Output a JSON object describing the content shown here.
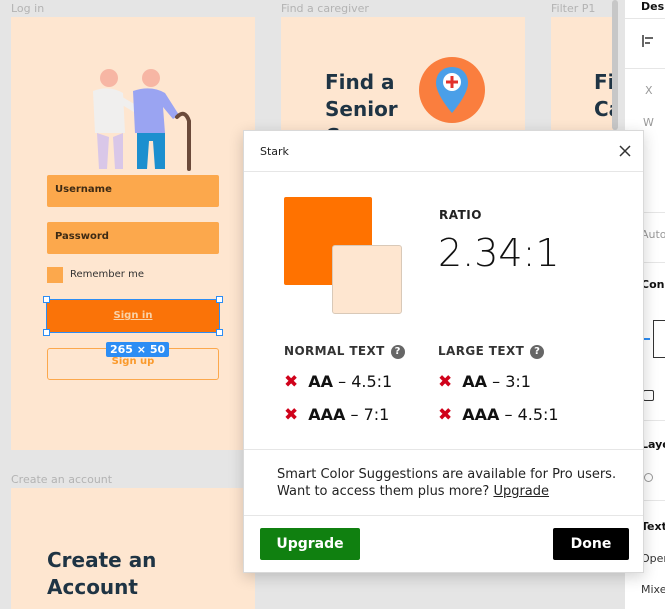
{
  "canvas": {
    "frames": {
      "login": {
        "label": "Log in",
        "username_label": "Username",
        "password_label": "Password",
        "remember_label": "Remember me",
        "signin_label": "Sign in",
        "signup_label": "Sign up",
        "selection_size": "265 × 50"
      },
      "caregiver": {
        "label": "Find a caregiver",
        "heading_line1": "Find a",
        "heading_line2": "Senior",
        "heading_line3": "Care..."
      },
      "filter": {
        "label": "Filter P1",
        "heading_line1": "Filt",
        "heading_line2": "Cat"
      },
      "create": {
        "label": "Create an account",
        "heading_line1": "Create an",
        "heading_line2": "Account"
      }
    }
  },
  "right_panel": {
    "tab": "Desig",
    "x_label": "X",
    "w_label": "W",
    "auto_label": "Auto",
    "constraints_label": "Cons",
    "layer_label": "Laye",
    "text_label": "Text",
    "open_label": "Oper",
    "mixed_label": "Mixe"
  },
  "dialog": {
    "title": "Stark",
    "ratio_label": "RATIO",
    "ratio_value": "2.34:1",
    "foreground_color": "#ff7200",
    "background_color": "#fee6d0",
    "normal_text": {
      "label": "NORMAL TEXT",
      "aa_level": "AA",
      "aa_target": "– 4.5:1",
      "aaa_level": "AAA",
      "aaa_target": "– 7:1"
    },
    "large_text": {
      "label": "LARGE TEXT",
      "aa_level": "AA",
      "aa_target": "– 3:1",
      "aaa_level": "AAA",
      "aaa_target": "– 4.5:1"
    },
    "fail_icon": "✖",
    "help_icon": "?",
    "suggestion_line1": "Smart Color Suggestions are available for Pro users.",
    "suggestion_line2": "Want to access them plus more?",
    "suggestion_link": "Upgrade",
    "upgrade_button": "Upgrade",
    "done_button": "Done"
  }
}
